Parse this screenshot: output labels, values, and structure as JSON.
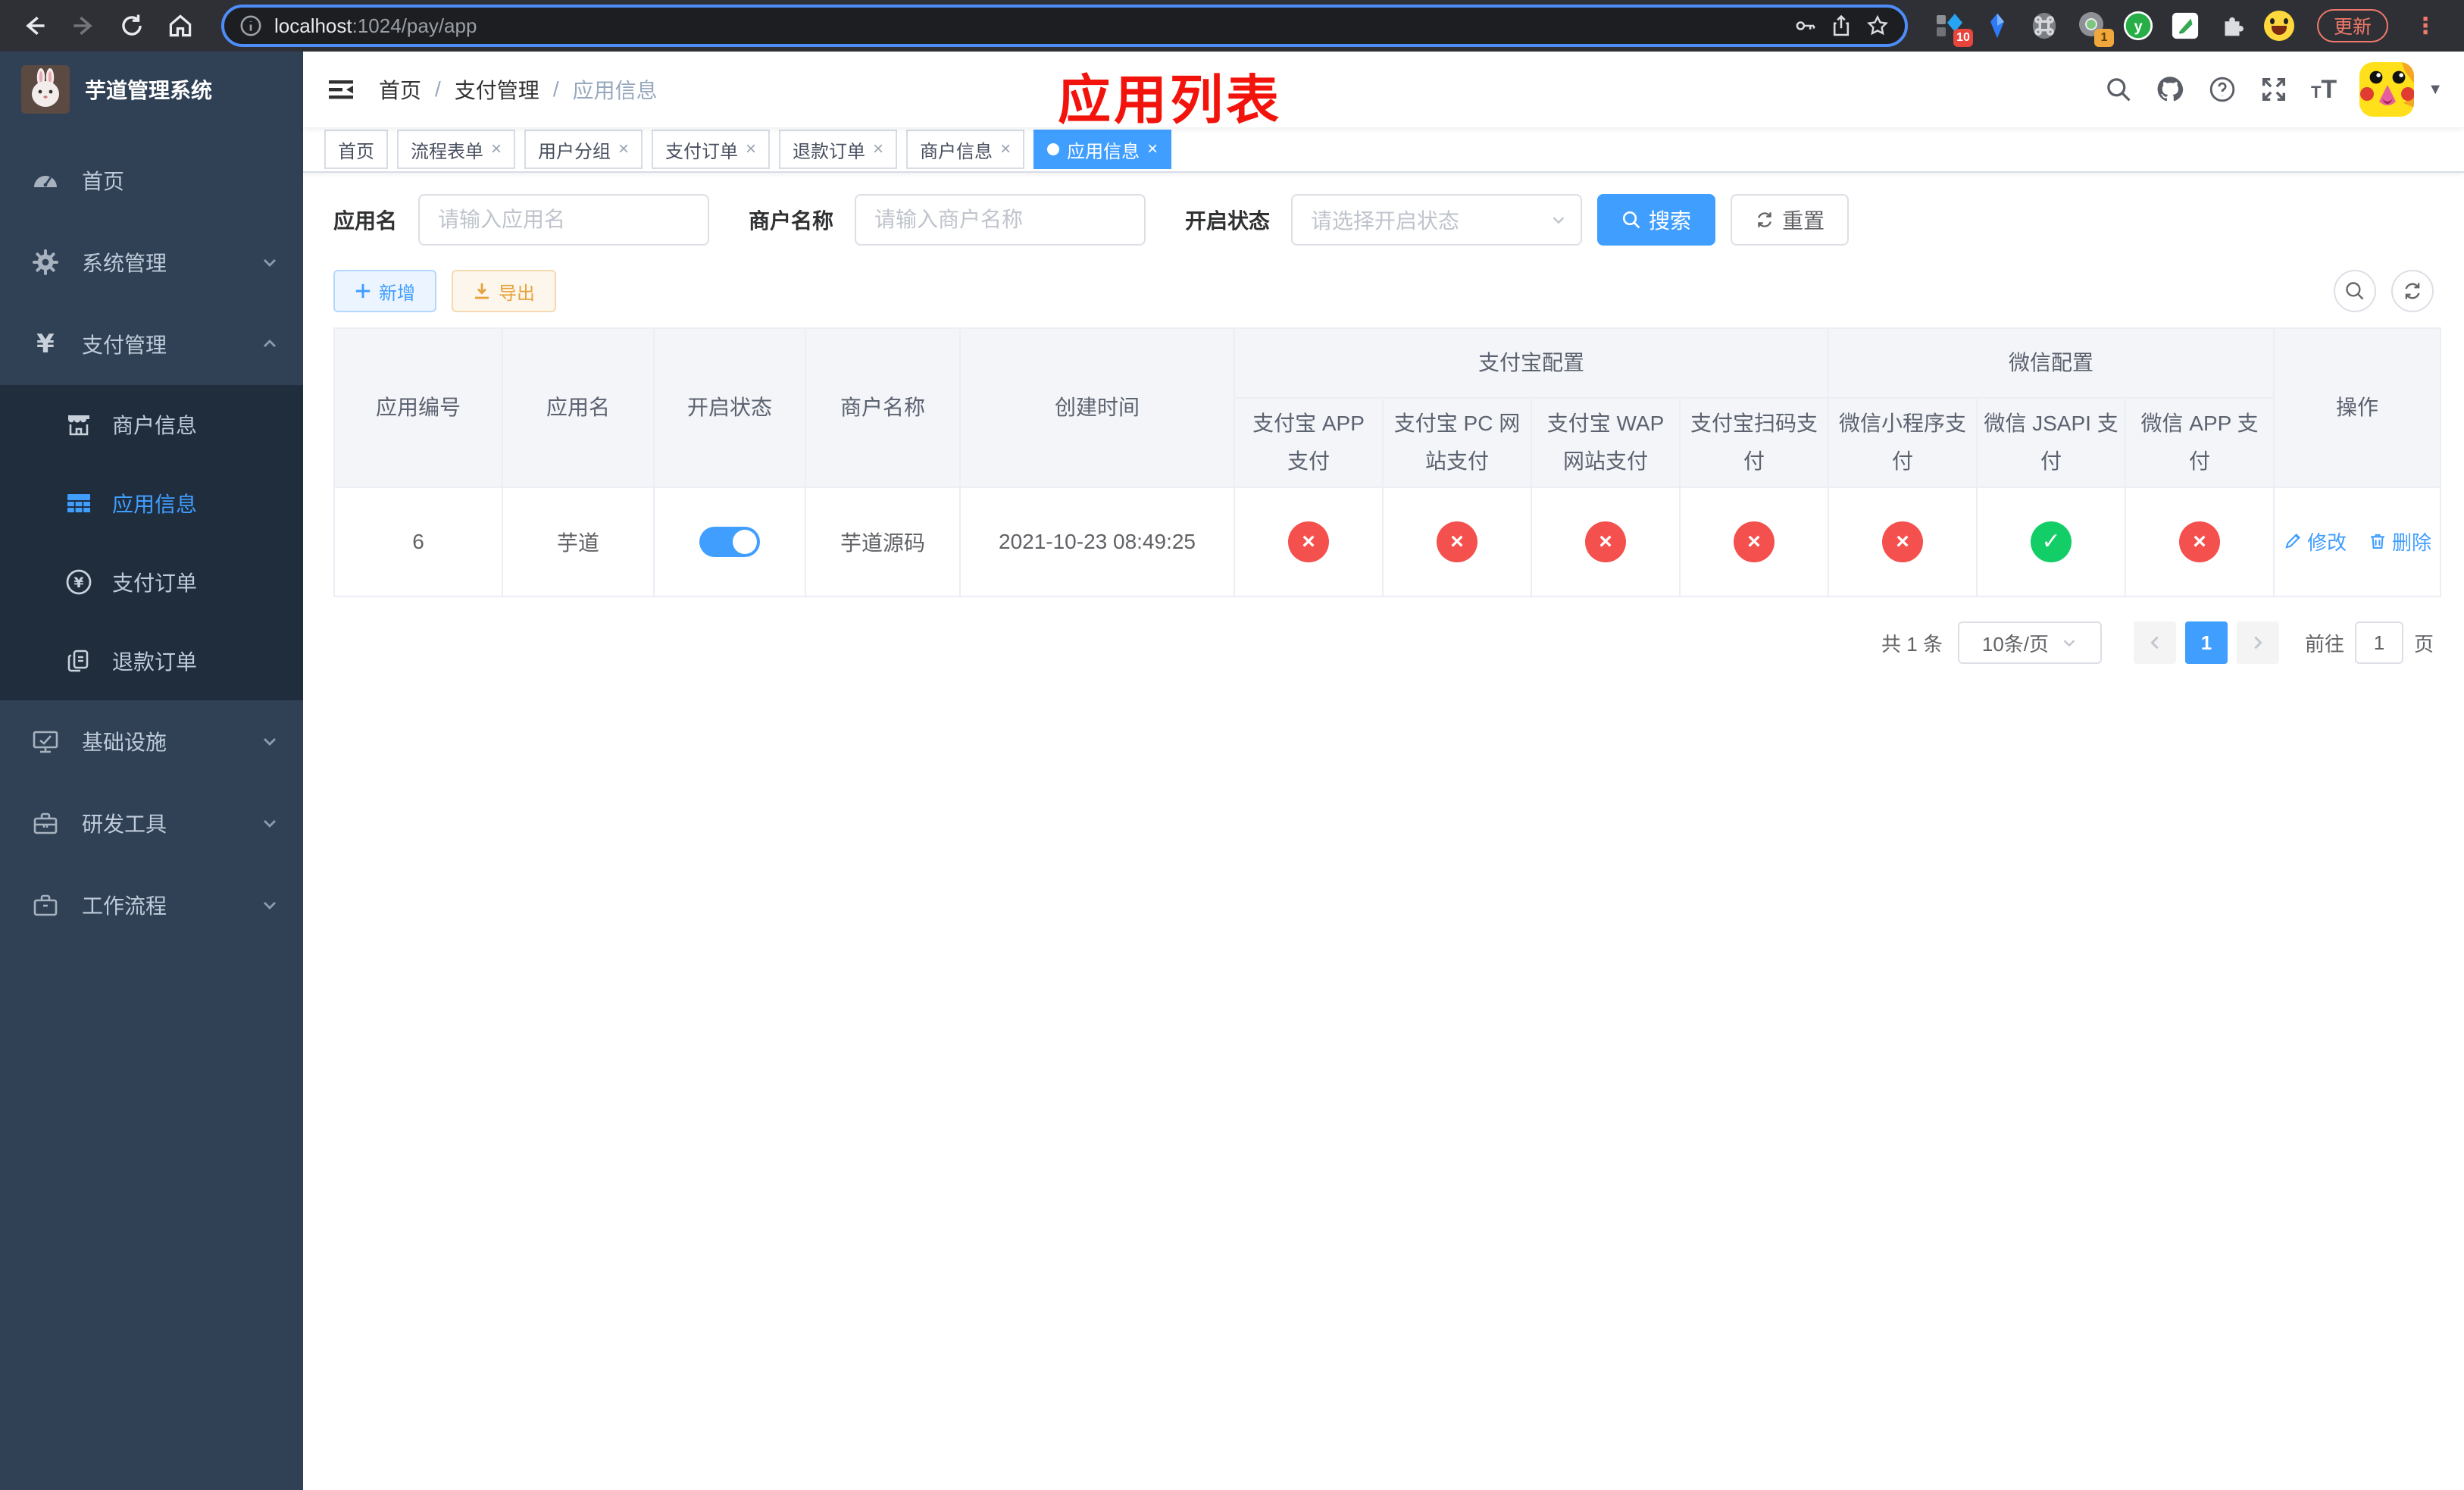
{
  "browser": {
    "url_host": "localhost",
    "url_rest": ":1024/pay/app",
    "update_label": "更新",
    "ext_pin_badge": "10",
    "ext_meet_badge": "1",
    "ext_y_letter": "y"
  },
  "sidebar": {
    "title": "芋道管理系统",
    "items": [
      {
        "label": "首页"
      },
      {
        "label": "系统管理"
      },
      {
        "label": "支付管理",
        "children": [
          {
            "label": "商户信息"
          },
          {
            "label": "应用信息",
            "active": true
          },
          {
            "label": "支付订单"
          },
          {
            "label": "退款订单"
          }
        ]
      },
      {
        "label": "基础设施"
      },
      {
        "label": "研发工具"
      },
      {
        "label": "工作流程"
      }
    ]
  },
  "navbar": {
    "breadcrumb": [
      "首页",
      "支付管理",
      "应用信息"
    ],
    "separator": "/",
    "annotation": "应用列表"
  },
  "tabs": [
    {
      "label": "首页",
      "closable": false,
      "active": false
    },
    {
      "label": "流程表单",
      "closable": true,
      "active": false
    },
    {
      "label": "用户分组",
      "closable": true,
      "active": false
    },
    {
      "label": "支付订单",
      "closable": true,
      "active": false
    },
    {
      "label": "退款订单",
      "closable": true,
      "active": false
    },
    {
      "label": "商户信息",
      "closable": true,
      "active": false
    },
    {
      "label": "应用信息",
      "closable": true,
      "active": true
    }
  ],
  "filter": {
    "app_name_label": "应用名",
    "app_name_placeholder": "请输入应用名",
    "merchant_label": "商户名称",
    "merchant_placeholder": "请输入商户名称",
    "status_label": "开启状态",
    "status_placeholder": "请选择开启状态",
    "search_label": "搜索",
    "reset_label": "重置"
  },
  "toolbar": {
    "add_label": "新增",
    "export_label": "导出"
  },
  "table": {
    "columns": [
      "应用编号",
      "应用名",
      "开启状态",
      "商户名称",
      "创建时间"
    ],
    "groups": [
      {
        "label": "支付宝配置",
        "children": [
          "支付宝 APP 支付",
          "支付宝 PC 网站支付",
          "支付宝 WAP 网站支付",
          "支付宝扫码支付"
        ]
      },
      {
        "label": "微信配置",
        "children": [
          "微信小程序支付",
          "微信 JSAPI 支付",
          "微信 APP 支付"
        ]
      }
    ],
    "action_col": "操作",
    "row": {
      "id": "6",
      "name": "芋道",
      "enabled": true,
      "merchant": "芋道源码",
      "created": "2021-10-23 08:49:25",
      "statuses": [
        "cross",
        "cross",
        "cross",
        "cross",
        "cross",
        "check",
        "cross"
      ],
      "edit_label": "修改",
      "delete_label": "删除"
    }
  },
  "pagination": {
    "total": "共 1 条",
    "page_size": "10条/页",
    "page": "1",
    "goto_label": "前往",
    "goto_value": "1",
    "unit_label": "页"
  },
  "colors": {
    "accent": "#409eff",
    "success": "#13ce66",
    "danger": "#f4504d",
    "warning": "#e6a23c",
    "sidebar_bg": "#304156",
    "submenu_bg": "#1f2d3d",
    "annotation": "#f2140c",
    "omnibox_ring": "#4e8df7",
    "chrome_bg": "#2e3035"
  }
}
